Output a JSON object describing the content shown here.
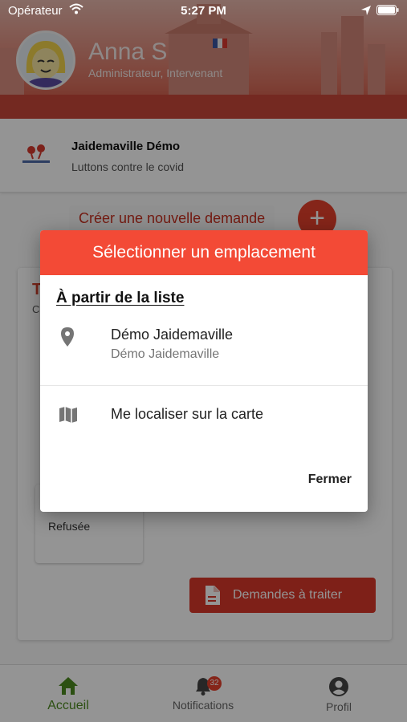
{
  "status_bar": {
    "carrier": "Opérateur",
    "time": "5:27 PM"
  },
  "user": {
    "name": "Anna S",
    "role": "Administrateur, Intervenant"
  },
  "organization": {
    "name": "Jaidemaville Démo",
    "tagline": "Luttons contre le covid"
  },
  "create_request": {
    "label": "Créer une nouvelle demande",
    "button_symbol": "+"
  },
  "background_panel": {
    "title": "T",
    "subtitle": "C",
    "tile_status": "Refusée",
    "pending_button": "Demandes à traiter"
  },
  "dialog": {
    "title": "Sélectionner un emplacement",
    "section_heading": "À partir de la liste",
    "options": [
      {
        "icon": "location-pin-icon",
        "title": "Démo Jaidemaville",
        "subtitle": "Démo Jaidemaville"
      },
      {
        "icon": "map-icon",
        "title": "Me localiser sur la carte"
      }
    ],
    "close_label": "Fermer"
  },
  "bottom_nav": {
    "items": [
      {
        "icon": "home-icon",
        "label": "Accueil",
        "active": true
      },
      {
        "icon": "bell-icon",
        "label": "Notifications",
        "badge": "32"
      },
      {
        "icon": "account-icon",
        "label": "Profil"
      }
    ]
  },
  "colors": {
    "accent": "#f34a36",
    "active_nav": "#4d8a1f",
    "button_red": "#d9382a"
  }
}
